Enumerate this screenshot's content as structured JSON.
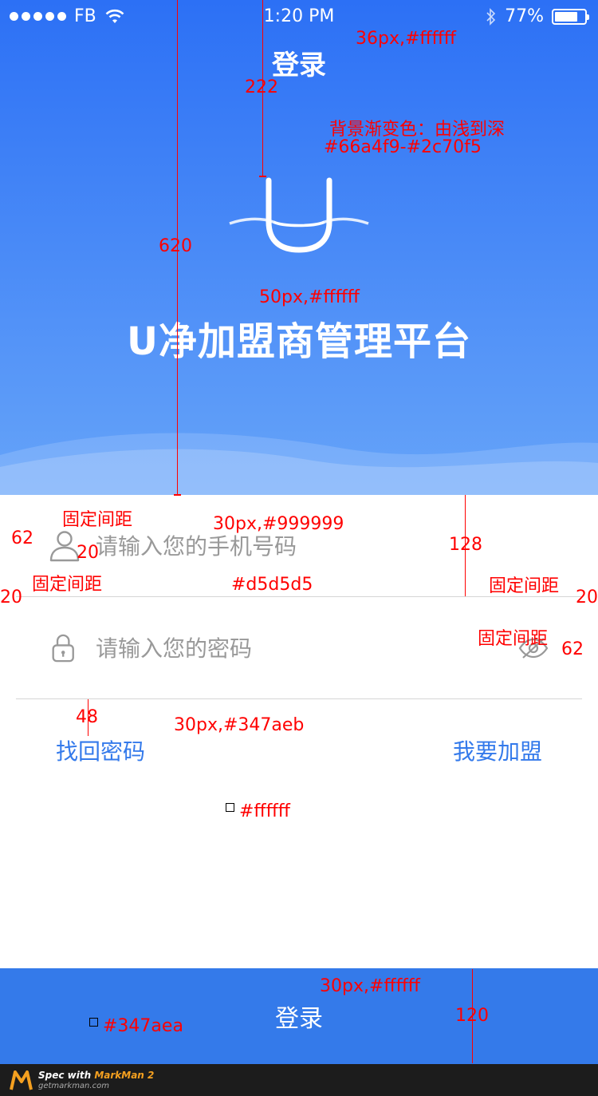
{
  "status_bar": {
    "carrier": "FB",
    "time": "1:20 PM",
    "battery": "77%",
    "battery_level": 0.77
  },
  "header": {
    "title": "登录",
    "app_name": "U净加盟商管理平台",
    "gradient": {
      "from": "#66a4f9",
      "to": "#2c70f5"
    }
  },
  "form": {
    "phone_placeholder": "请输入您的手机号码",
    "password_placeholder": "请输入您的密码",
    "forgot_password": "找回密码",
    "join": "我要加盟",
    "divider_color": "#d5d5d5",
    "link_color": "#347aeb"
  },
  "login_button": {
    "label": "登录",
    "color": "#347aea"
  },
  "annotations": {
    "title_spec": "36px,#ffffff",
    "h222": "222",
    "bg_note": "背景渐变色：由浅到深",
    "bg_colors": "#66a4f9-#2c70f5",
    "h620": "620",
    "app_name_spec": "50px,#ffffff",
    "fixed_spacing": "固定间距",
    "n62": "62",
    "n20": "20",
    "placeholder_spec": "30px,#999999",
    "h128": "128",
    "divider_spec": "#d5d5d5",
    "h48": "48",
    "link_spec": "30px,#347aeb",
    "white_spec": "#ffffff",
    "button_spec": "30px,#ffffff",
    "h120": "120",
    "button_color_spec": "#347aea"
  },
  "footer": {
    "brand": "Spec with",
    "product": "MarkMan 2",
    "url": "getmarkman.com"
  }
}
